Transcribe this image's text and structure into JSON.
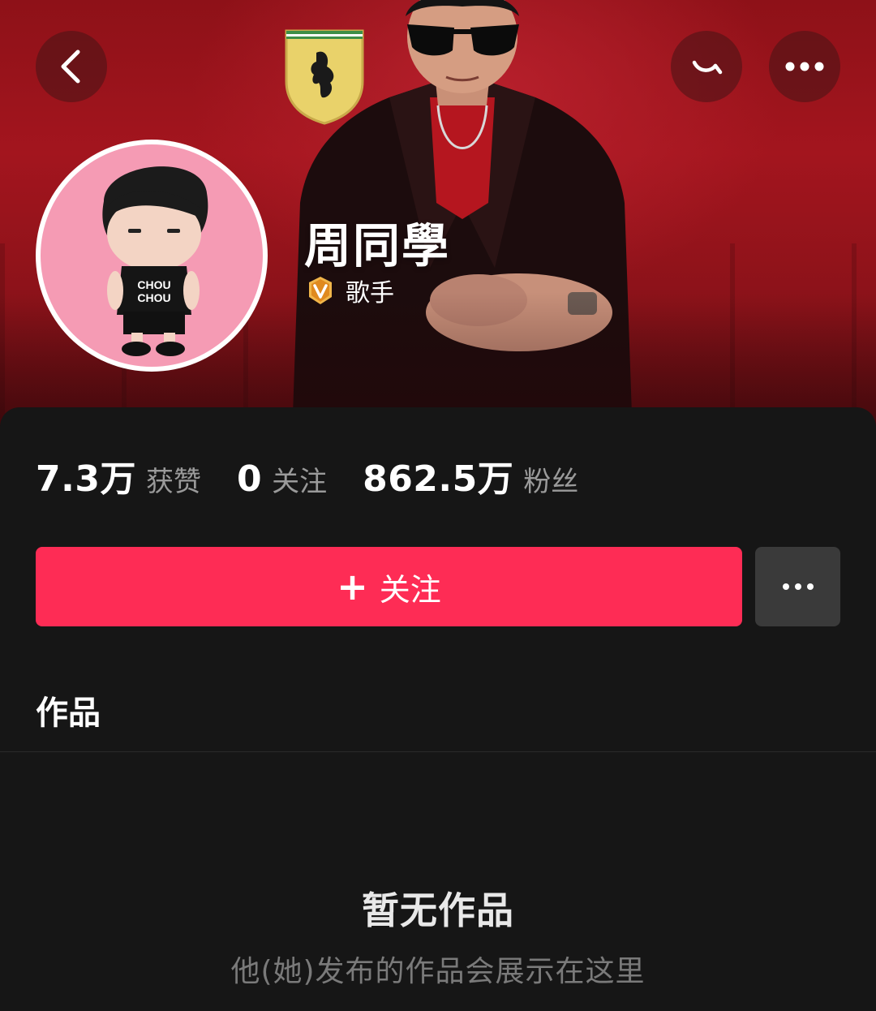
{
  "header": {
    "icons": {
      "back": "chevron-left-icon",
      "search": "search-icon",
      "more": "more-horizontal-icon"
    }
  },
  "profile": {
    "name": "周同學",
    "verified_icon": "verified-badge-icon",
    "tag": "歌手",
    "avatar_text_line1": "CHOU",
    "avatar_text_line2": "CHOU"
  },
  "stats": [
    {
      "value": "7.3万",
      "label": "获赞"
    },
    {
      "value": "0",
      "label": "关注"
    },
    {
      "value": "862.5万",
      "label": "粉丝"
    }
  ],
  "actions": {
    "follow_plus": "+",
    "follow_label": "关注",
    "more_icon": "more-horizontal-icon"
  },
  "tabs": {
    "works": "作品"
  },
  "empty_state": {
    "title": "暂无作品",
    "subtitle": "他(她)发布的作品会展示在这里"
  },
  "colors": {
    "accent": "#fe2c55",
    "background": "#161616",
    "hero": "#a3151e"
  }
}
